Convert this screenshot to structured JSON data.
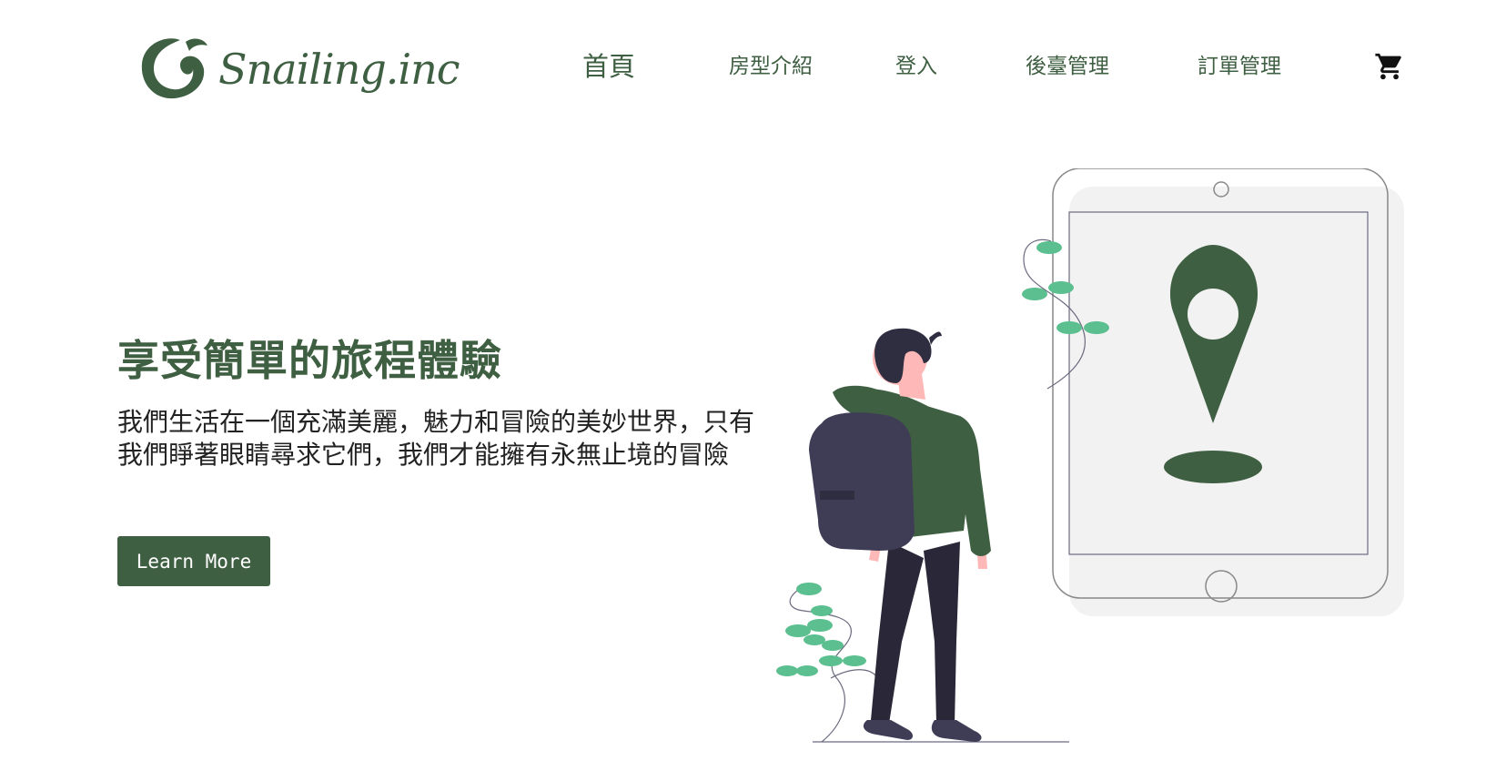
{
  "brand": {
    "name": "Snailing.inc"
  },
  "nav": {
    "home": "首頁",
    "rooms": "房型介紹",
    "login": "登入",
    "admin": "後臺管理",
    "orders": "訂單管理",
    "cart_icon": "shopping-cart-icon"
  },
  "hero": {
    "title": "享受簡單的旅程體驗",
    "description": "我們生活在一個充滿美麗，魅力和冒險的美妙世界，只有我們睜著眼睛尋求它們，我們才能擁有永無止境的冒險",
    "button_label": "Learn More"
  },
  "colors": {
    "brand_green": "#3f5f42",
    "leaf_green": "#5bbf8f",
    "tablet_fill": "#f2f2f2"
  }
}
